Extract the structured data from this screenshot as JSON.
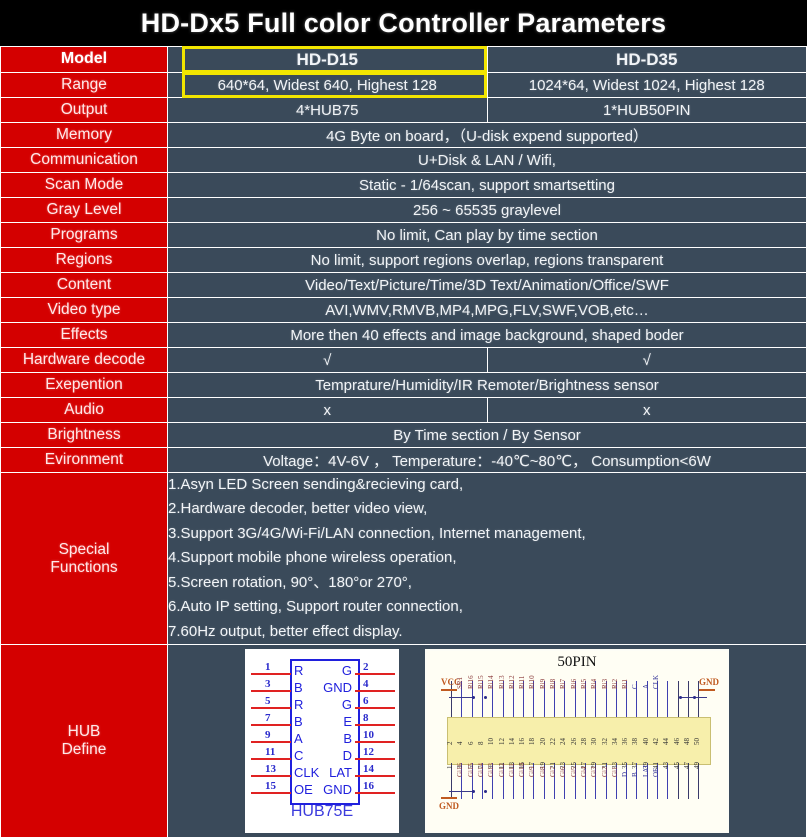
{
  "title": "HD-Dx5 Full color Controller Parameters",
  "colors": {
    "label_bg": "#D40000",
    "value_bg": "#3A4A5A",
    "highlight": "#F2E500",
    "title_bg": "#000000",
    "grid": "#FFFFFF"
  },
  "columns": {
    "model_a": "HD-D15",
    "model_b": "HD-D35"
  },
  "rows": [
    {
      "label": "Model",
      "split": true,
      "a": "HD-D15",
      "b": "HD-D35",
      "header": true,
      "highlight_a": true
    },
    {
      "label": "Range",
      "split": true,
      "a": "640*64, Widest 640, Highest 128",
      "b": "1024*64, Widest 1024, Highest 128",
      "highlight_a": true
    },
    {
      "label": "Output",
      "split": true,
      "a": "4*HUB75",
      "b": "1*HUB50PIN"
    },
    {
      "label": "Memory",
      "split": false,
      "value": "4G Byte on board，（U-disk expend supported）"
    },
    {
      "label": "Communication",
      "split": false,
      "value": "U+Disk & LAN / Wifi,"
    },
    {
      "label": "Scan Mode",
      "split": false,
      "value": "Static - 1/64scan,   support smartsetting"
    },
    {
      "label": "Gray Level",
      "split": false,
      "value": "256 ~ 65535 graylevel"
    },
    {
      "label": "Programs",
      "split": false,
      "value": "No limit,   Can play by time section"
    },
    {
      "label": "Regions",
      "split": false,
      "value": "No limit,   support regions overlap,   regions transparent"
    },
    {
      "label": "Content",
      "split": false,
      "value": "Video/Text/Picture/Time/3D Text/Animation/Office/SWF"
    },
    {
      "label": "Video type",
      "split": false,
      "value": "AVI,WMV,RMVB,MP4,MPG,FLV,SWF,VOB,etc…"
    },
    {
      "label": "Effects",
      "split": false,
      "value": "More then 40 effects and image background, shaped boder"
    },
    {
      "label": "Hardware decode",
      "split": true,
      "a": "√",
      "b": "√"
    },
    {
      "label": "Exepention",
      "split": false,
      "value": "Temprature/Humidity/IR Remoter/Brightness sensor"
    },
    {
      "label": "Audio",
      "split": true,
      "a": "x",
      "b": "x"
    },
    {
      "label": "Brightness",
      "split": false,
      "value": "By Time section / By Sensor"
    },
    {
      "label": "Evironment",
      "split": false,
      "value": "Voltage：4V-6V ，  Temperature：-40℃~80℃，  Consumption<6W"
    }
  ],
  "special": {
    "label_line1": "Special",
    "label_line2": "Functions",
    "items": [
      "1.Asyn LED Screen sending&recieving card,",
      "2.Hardware decoder, better video view,",
      "3.Support 3G/4G/Wi-Fi/LAN connection,   Internet management,",
      "4.Support mobile phone wireless operation,",
      "5.Screen rotation,  90°、180°or 270°,",
      "6.Auto IP setting,   Support router connection,",
      "7.60Hz output, better effect display."
    ]
  },
  "hub": {
    "label_line1": "HUB",
    "label_line2": "Define",
    "hub75": {
      "caption": "HUB75E",
      "left_signals": [
        "R",
        "B",
        "R",
        "B",
        "A",
        "C",
        "CLK",
        "OE"
      ],
      "right_signals": [
        "G",
        "GND",
        "G",
        "E",
        "B",
        "D",
        "LAT",
        "GND"
      ],
      "left_pins": [
        "1",
        "3",
        "5",
        "7",
        "9",
        "11",
        "13",
        "15"
      ],
      "right_pins": [
        "2",
        "4",
        "6",
        "8",
        "10",
        "12",
        "14",
        "16"
      ]
    },
    "pin50": {
      "title": "50PIN",
      "top_labels": [
        "VCC",
        "SR1",
        "Ri16",
        "Ri15",
        "Ri14",
        "Ri13",
        "Ri12",
        "Ri11",
        "Ri10",
        "Ri9",
        "Ri8",
        "Ri7",
        "Ri6",
        "Ri5",
        "Ri4",
        "Ri3",
        "Ri2",
        "Ri1",
        "C",
        "A",
        "CLK",
        "GND"
      ],
      "bottom_labels": [
        "GND",
        "Gi16",
        "Gi15",
        "Gi14",
        "Gi13",
        "Gi12",
        "Gi11",
        "Gi10",
        "Gi9",
        "Gi8",
        "Gi7",
        "Gi6",
        "Gi5",
        "Gi4",
        "Gi3",
        "Gi2",
        "Gi1",
        "D",
        "B",
        "LAT",
        "OE"
      ],
      "top_numbers": [
        "2",
        "4",
        "6",
        "8",
        "10",
        "12",
        "14",
        "16",
        "18",
        "20",
        "22",
        "24",
        "26",
        "28",
        "30",
        "32",
        "34",
        "36",
        "38",
        "40",
        "42",
        "44",
        "46",
        "48",
        "50"
      ],
      "bottom_numbers": [
        "1",
        "3",
        "5",
        "7",
        "9",
        "11",
        "13",
        "15",
        "17",
        "19",
        "21",
        "23",
        "25",
        "27",
        "29",
        "31",
        "33",
        "35",
        "37",
        "39",
        "41",
        "43",
        "45",
        "47",
        "49"
      ],
      "power_top_left": "VCC",
      "power_top_right": "GND",
      "power_bottom_left": "GND"
    }
  }
}
